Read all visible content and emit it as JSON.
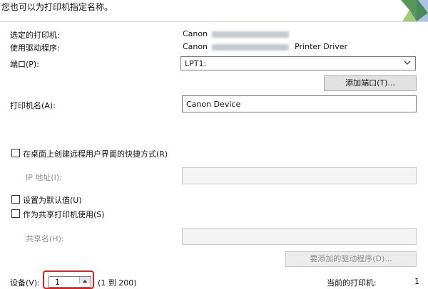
{
  "header": {
    "description": "您也可以为打印机指定名称。"
  },
  "printer_info": {
    "selected_printer_label": "选定的打印机:",
    "selected_printer_value": "Canon",
    "driver_label": "使用驱动程序:",
    "driver_value_prefix": "Canon",
    "driver_value_suffix": "Printer Driver"
  },
  "port": {
    "label": "端口(P):",
    "selected": "LPT1:",
    "add_port_button": "添加端口(T)..."
  },
  "printer_name": {
    "label": "打印机名(A):",
    "value": "Canon Device"
  },
  "options": {
    "shortcut_checkbox": "在桌面上创建远程用户界面的快捷方式(R)",
    "ip_label": "IP 地址(I):",
    "default_checkbox": "设置为默认值(U)",
    "share_checkbox": "作为共享打印机使用(S)",
    "share_name_label": "共享名(H):",
    "drivers_button": "要添加的驱动程序(D)..."
  },
  "device_count": {
    "label": "设备(V):",
    "value": "1",
    "range": "(1 到 200)",
    "current_label": "当前的打印机:",
    "current_value": "1"
  },
  "colors": {
    "highlight": "#e02020",
    "button_bg": "#e1e1e1",
    "disabled_text": "#8f8f8f"
  },
  "icons": [
    "installer-logo-icon",
    "chevron-down-icon",
    "spin-up-icon"
  ]
}
